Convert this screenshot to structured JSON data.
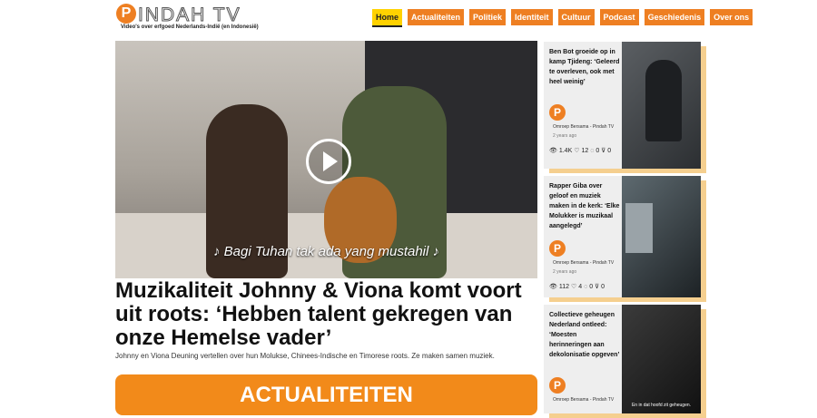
{
  "site": {
    "logo_letter": "P",
    "logo_text": "INDAH TV",
    "tagline": "Video's over erfgoed Nederlands-Indië (en Indonesië)"
  },
  "nav": {
    "items": [
      {
        "label": "Home",
        "active": true
      },
      {
        "label": "Actualiteiten"
      },
      {
        "label": "Politiek"
      },
      {
        "label": "Identiteit"
      },
      {
        "label": "Cultuur"
      },
      {
        "label": "Podcast"
      },
      {
        "label": "Geschiedenis"
      },
      {
        "label": "Over ons"
      }
    ]
  },
  "featured": {
    "video_subtitle": "♪ Bagi Tuhan tak ada yang mustahil ♪",
    "title": "Muzikaliteit Johnny & Viona komt voort uit roots: ‘Hebben talent gekregen van onze Hemelse vader’",
    "lede": "Johnny en Viona Deuning vertellen over hun Molukse, Chinees-Indische en Timorese roots. Ze maken samen muziek."
  },
  "section_banner": "ACTUALITEITEN",
  "sidebar": {
    "cards": [
      {
        "title": "Ben Bot groeide op in kamp Tjideng: ‘Geleerd te overleven, ook met heel weinig’",
        "author": "Omroep Bersama - Pindah TV",
        "date": "2 years ago",
        "views": "1.4K",
        "likes": "12",
        "comments": "0",
        "dislikes": "0"
      },
      {
        "title": "Rapper Giba over geloof en muziek maken in de kerk: ‘Elke Molukker is muzikaal aangelegd’",
        "author": "Omroep Bersama - Pindah TV",
        "date": "2 years ago",
        "views": "112",
        "likes": "4",
        "comments": "0",
        "dislikes": "0"
      },
      {
        "title": "Collectieve geheugen Nederland ontleed: ‘Moesten herinneringen aan dekolonisatie opgeven’",
        "author": "Omroep Bersama - Pindah TV",
        "date": "",
        "img_caption": "En in dat hoofd zit geheugen."
      }
    ]
  },
  "icons": {
    "views": "views-icon",
    "likes": "heart-icon",
    "comments": "comment-icon",
    "dislikes": "thumbs-down-icon"
  },
  "colors": {
    "accent": "#ee7f22",
    "active_nav": "#ffd200",
    "banner": "#f28a1a"
  }
}
